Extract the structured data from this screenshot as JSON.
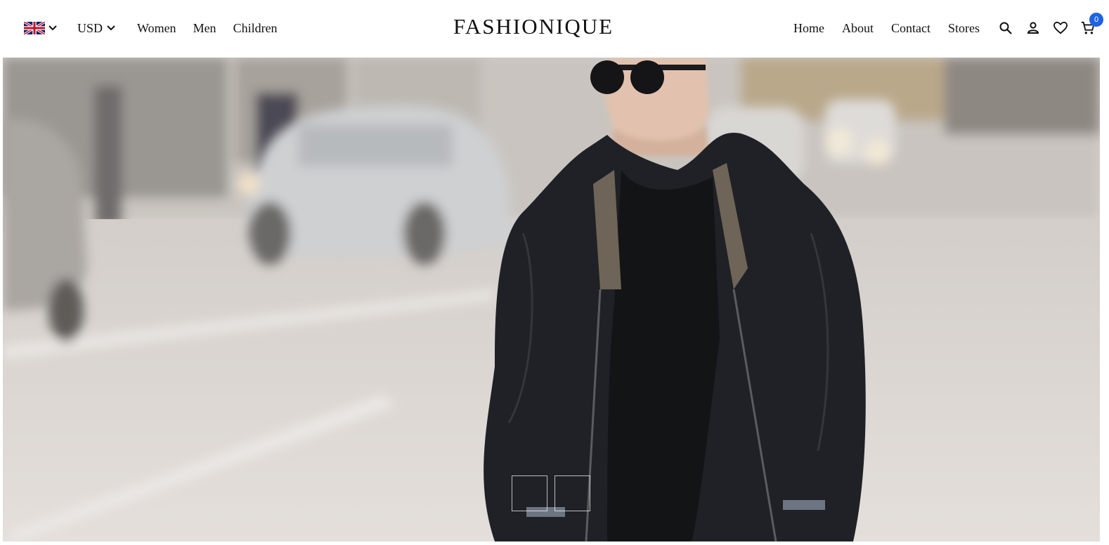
{
  "header": {
    "language_flag": "uk-flag-icon",
    "currency": "USD",
    "left_links": [
      "Women",
      "Men",
      "Children"
    ],
    "brand": "FASHIONIQUE",
    "right_links": [
      "Home",
      "About",
      "Contact",
      "Stores"
    ],
    "cart_count": "0",
    "icons": [
      "search-icon",
      "user-icon",
      "heart-icon",
      "cart-icon"
    ]
  },
  "colors": {
    "badge": "#1f62e0",
    "text": "#111111",
    "background": "#ffffff"
  },
  "hero": {
    "slider": {
      "prev_icon": "arrow-left-icon",
      "next_icon": "arrow-right-icon"
    }
  }
}
